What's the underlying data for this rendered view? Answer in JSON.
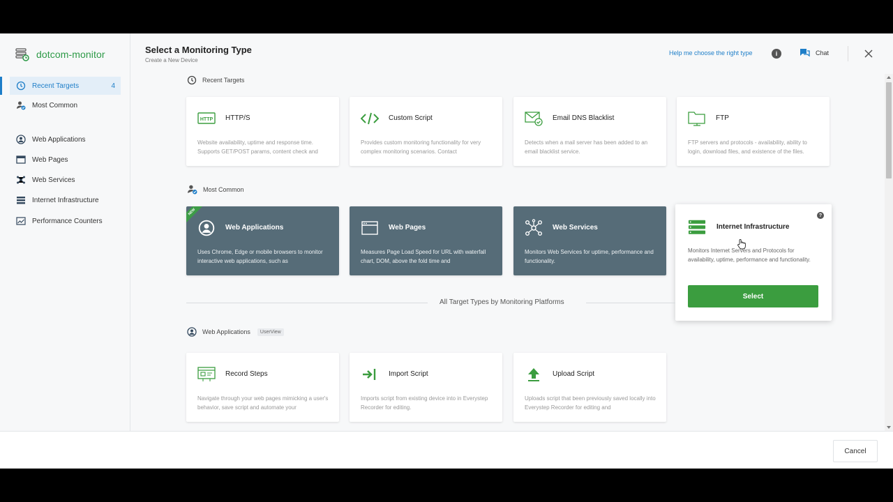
{
  "brand": {
    "logo_text": "dotcom-monitor"
  },
  "header": {
    "title": "Select a Monitoring Type",
    "subtitle": "Create a New Device",
    "help_link": "Help me choose the right type",
    "info_label": "i",
    "chat_label": "Chat"
  },
  "sidebar": {
    "items": [
      {
        "label": "Recent Targets",
        "count": "4",
        "active": true,
        "icon": "clock-icon"
      },
      {
        "label": "Most Common",
        "icon": "user-check-icon"
      },
      {
        "label": "Web Applications",
        "icon": "user-circle-icon"
      },
      {
        "label": "Web Pages",
        "icon": "browser-window-icon"
      },
      {
        "label": "Web Services",
        "icon": "network-icon"
      },
      {
        "label": "Internet Infrastructure",
        "icon": "server-icon"
      },
      {
        "label": "Performance Counters",
        "icon": "chart-icon"
      }
    ]
  },
  "sections": {
    "recent": {
      "heading": "Recent Targets",
      "cards": [
        {
          "title": "HTTP/S",
          "icon": "http-icon",
          "desc": "Website availability, uptime and response time. Supports GET/POST params, content check and"
        },
        {
          "title": "Custom Script",
          "icon": "code-icon",
          "desc": "Provides custom monitoring functionality for very complex monitoring scenarios. Contact"
        },
        {
          "title": "Email DNS Blacklist",
          "icon": "mail-check-icon",
          "desc": "Detects when a mail server has been added to an email blacklist service."
        },
        {
          "title": "FTP",
          "icon": "folder-icon",
          "desc": "FTP servers and protocols - availability, ability to login, download files, and existence of the files."
        }
      ]
    },
    "common": {
      "heading": "Most Common",
      "new_badge": "NEW",
      "cards": [
        {
          "title": "Web Applications",
          "icon": "user-circle-icon",
          "desc": "Uses Chrome, Edge or mobile browsers to monitor interactive web applications, such as"
        },
        {
          "title": "Web Pages",
          "icon": "browser-window-icon",
          "desc": "Measures Page Load Speed for URL with waterfall chart, DOM, above the fold time and"
        },
        {
          "title": "Web Services",
          "icon": "network-icon",
          "desc": "Monitors Web Services for uptime, performance and functionality."
        },
        {
          "title": "Internet Infrastructure",
          "icon": "server-icon",
          "desc": "Monitors Internet Servers and Protocols for availability, uptime, performance and functionality.",
          "select_label": "Select",
          "help": "?"
        }
      ]
    },
    "divider_text": "All Target Types by Monitoring Platforms",
    "webapps": {
      "heading": "Web Applications",
      "tag": "UserView",
      "cards": [
        {
          "title": "Record Steps",
          "icon": "record-steps-icon",
          "desc": "Navigate through your web pages mimicking a user's behavior, save script and automate your"
        },
        {
          "title": "Import Script",
          "icon": "import-icon",
          "desc": "Imports script from existing device into in Everystep Recorder for editing."
        },
        {
          "title": "Upload Script",
          "icon": "upload-icon",
          "desc": "Uploads script that been previously saved locally into Everystep Recorder for editing and"
        }
      ]
    }
  },
  "footer": {
    "cancel_label": "Cancel"
  },
  "colors": {
    "accent": "#1e7ec8",
    "green": "#3b9d3f",
    "dark_card": "#566c78"
  }
}
